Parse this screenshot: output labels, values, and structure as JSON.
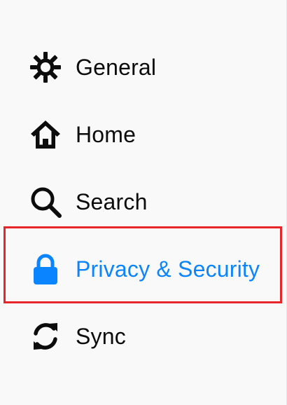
{
  "sidebar": {
    "items": [
      {
        "label": "General",
        "icon": "gear-icon"
      },
      {
        "label": "Home",
        "icon": "home-icon"
      },
      {
        "label": "Search",
        "icon": "search-icon"
      },
      {
        "label": "Privacy & Security",
        "icon": "lock-icon",
        "selected": true
      },
      {
        "label": "Sync",
        "icon": "sync-icon"
      }
    ]
  },
  "colors": {
    "background": "#f9f9fa",
    "text": "#0c0c0d",
    "accent": "#0a84ff",
    "highlight_border": "#e8262a"
  }
}
